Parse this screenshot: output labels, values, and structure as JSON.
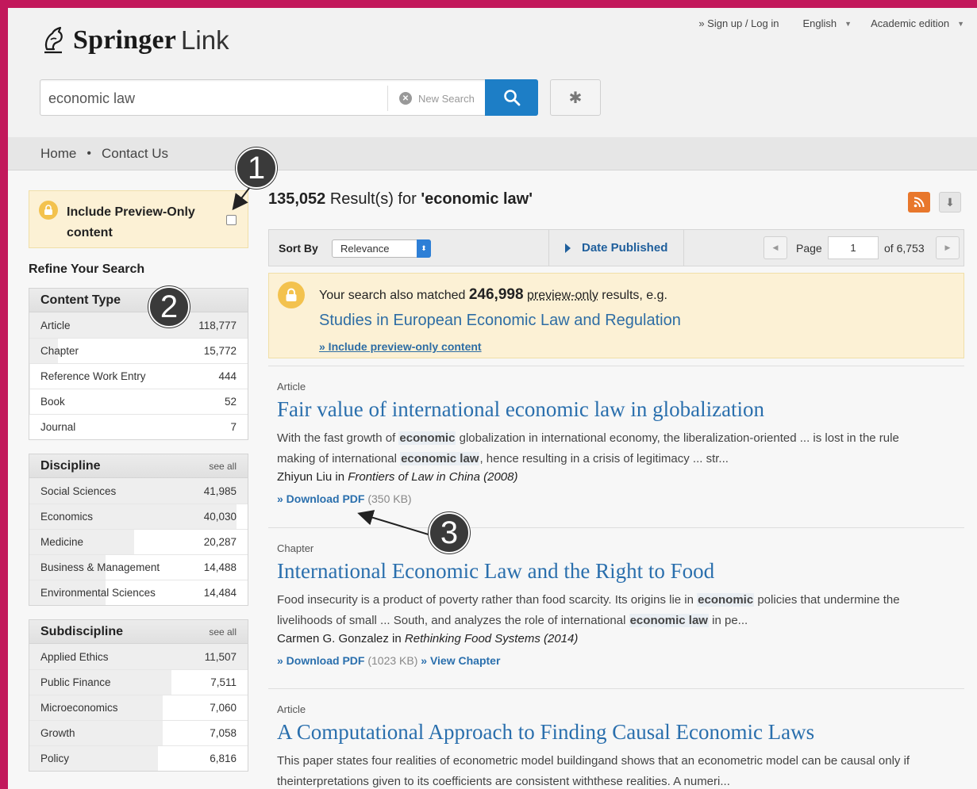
{
  "header": {
    "logo_springer": "Springer",
    "logo_link": "Link",
    "signup": "» Sign up / Log in",
    "language": "English",
    "edition": "Academic edition"
  },
  "search": {
    "query": "economic law",
    "new_search": "New Search"
  },
  "nav": {
    "home": "Home",
    "contact": "Contact Us"
  },
  "preview": {
    "label": "Include Preview-Only content"
  },
  "refine_title": "Refine Your Search",
  "facets": {
    "content_type": {
      "title": "Content Type",
      "items": [
        {
          "label": "Article",
          "count": "118,777",
          "share": 1.0
        },
        {
          "label": "Chapter",
          "count": "15,772",
          "share": 0.13
        },
        {
          "label": "Reference Work Entry",
          "count": "444",
          "share": 0.004
        },
        {
          "label": "Book",
          "count": "52",
          "share": 0.001
        },
        {
          "label": "Journal",
          "count": "7",
          "share": 0.0
        }
      ]
    },
    "discipline": {
      "title": "Discipline",
      "see_all": "see all",
      "items": [
        {
          "label": "Social Sciences",
          "count": "41,985",
          "share": 1.0
        },
        {
          "label": "Economics",
          "count": "40,030",
          "share": 0.95
        },
        {
          "label": "Medicine",
          "count": "20,287",
          "share": 0.48
        },
        {
          "label": "Business & Management",
          "count": "14,488",
          "share": 0.35
        },
        {
          "label": "Environmental Sciences",
          "count": "14,484",
          "share": 0.35
        }
      ]
    },
    "subdiscipline": {
      "title": "Subdiscipline",
      "see_all": "see all",
      "items": [
        {
          "label": "Applied Ethics",
          "count": "11,507",
          "share": 1.0
        },
        {
          "label": "Public Finance",
          "count": "7,511",
          "share": 0.65
        },
        {
          "label": "Microeconomics",
          "count": "7,060",
          "share": 0.61
        },
        {
          "label": "Growth",
          "count": "7,058",
          "share": 0.61
        },
        {
          "label": "Policy",
          "count": "6,816",
          "share": 0.59
        }
      ]
    }
  },
  "results": {
    "count": "135,052",
    "label": "Result(s) for",
    "query_quoted": "'economic law'"
  },
  "sort": {
    "label": "Sort By",
    "selected": "Relevance",
    "date_published": "Date Published",
    "page_label": "Page",
    "page_value": "1",
    "page_of": "of 6,753"
  },
  "matched": {
    "prefix": "Your search also matched",
    "count": "246,998",
    "preview_only": "preview-only",
    "suffix": "results, e.g.",
    "example": "Studies in European Economic Law and Regulation",
    "include_link": "» Include preview-only content"
  },
  "items": [
    {
      "type": "Article",
      "title": "Fair value of international economic law in globalization",
      "snip": [
        {
          "t": "With the fast growth of "
        },
        {
          "t": "economic",
          "h": true
        },
        {
          "t": " globalization in international economy, the liberalization-oriented ... is lost in the rule making of international "
        },
        {
          "t": "economic law",
          "h": true
        },
        {
          "t": ", hence resulting in a crisis of legitimacy ... str..."
        }
      ],
      "author": "Zhiyun Liu in ",
      "source": "Frontiers of Law in China (2008)",
      "download": "» Download PDF",
      "size": " (350 KB)",
      "extra": ""
    },
    {
      "type": "Chapter",
      "title": "International Economic Law and the Right to Food",
      "snip": [
        {
          "t": "Food insecurity is a product of poverty rather than food scarcity. Its origins lie in "
        },
        {
          "t": "economic",
          "h": true
        },
        {
          "t": " policies that undermine the livelihoods of small ... South, and analyzes the role of international "
        },
        {
          "t": "economic law",
          "h": true
        },
        {
          "t": " in pe..."
        }
      ],
      "author": "Carmen G. Gonzalez in ",
      "source": "Rethinking Food Systems (2014)",
      "download": "» Download PDF",
      "size": " (1023 KB)",
      "extra": " » View Chapter"
    },
    {
      "type": "Article",
      "title": "A Computational Approach to Finding Causal Economic Laws",
      "snip": [
        {
          "t": "This paper states four realities of econometric model buildingand shows that an econometric model can be causal only if theinterpretations given to its coefficients are consistent withthese realities. A numeri..."
        }
      ],
      "author": "",
      "source": "",
      "download": "",
      "size": "",
      "extra": ""
    }
  ],
  "annotations": [
    "1",
    "2",
    "3"
  ],
  "colors": {
    "frame": "#c2185b",
    "link": "#2a6fad",
    "search_button": "#1d7ec6",
    "preview_bg": "#fcf1d5",
    "rss": "#e8772c"
  }
}
